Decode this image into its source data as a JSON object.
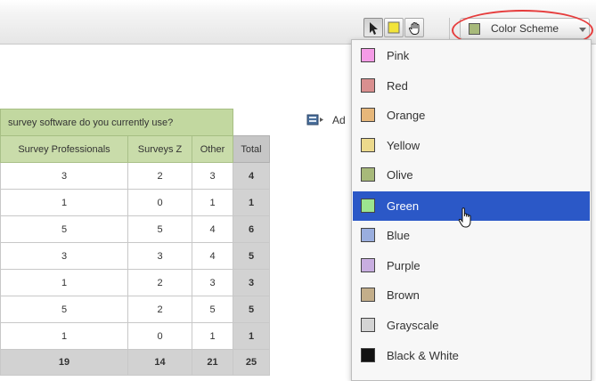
{
  "toolbar": {
    "tools": [
      {
        "name": "select-arrow-icon"
      },
      {
        "name": "yellow-square-icon",
        "color": "#f2e43a"
      },
      {
        "name": "hand-pan-icon"
      }
    ],
    "color_scheme_label": "Color Scheme",
    "color_scheme_swatch": "#a7b97a"
  },
  "table": {
    "title": "survey software do you currently use?",
    "headers": [
      "Survey Professionals",
      "Surveys Z",
      "Other",
      "Total"
    ],
    "rows": [
      [
        "3",
        "2",
        "3",
        "4"
      ],
      [
        "1",
        "0",
        "1",
        "1"
      ],
      [
        "5",
        "5",
        "4",
        "6"
      ],
      [
        "3",
        "3",
        "4",
        "5"
      ],
      [
        "1",
        "2",
        "3",
        "3"
      ],
      [
        "5",
        "2",
        "5",
        "5"
      ],
      [
        "1",
        "0",
        "1",
        "1"
      ]
    ],
    "totals": [
      "19",
      "14",
      "21",
      "25"
    ]
  },
  "add_action_label": "Ad",
  "color_scheme_menu": {
    "items": [
      {
        "label": "Pink",
        "color": "#f49be6"
      },
      {
        "label": "Red",
        "color": "#d98f8f"
      },
      {
        "label": "Orange",
        "color": "#e6b77a"
      },
      {
        "label": "Yellow",
        "color": "#ecd98c"
      },
      {
        "label": "Olive",
        "color": "#a7b97a"
      },
      {
        "label": "Green",
        "color": "#9ce58f",
        "selected": true
      },
      {
        "label": "Blue",
        "color": "#9aaede"
      },
      {
        "label": "Purple",
        "color": "#c8aee0"
      },
      {
        "label": "Brown",
        "color": "#c3ae8a"
      },
      {
        "label": "Grayscale",
        "color": "#d4d4d4"
      },
      {
        "label": "Black & White",
        "color": "#111111"
      }
    ]
  }
}
